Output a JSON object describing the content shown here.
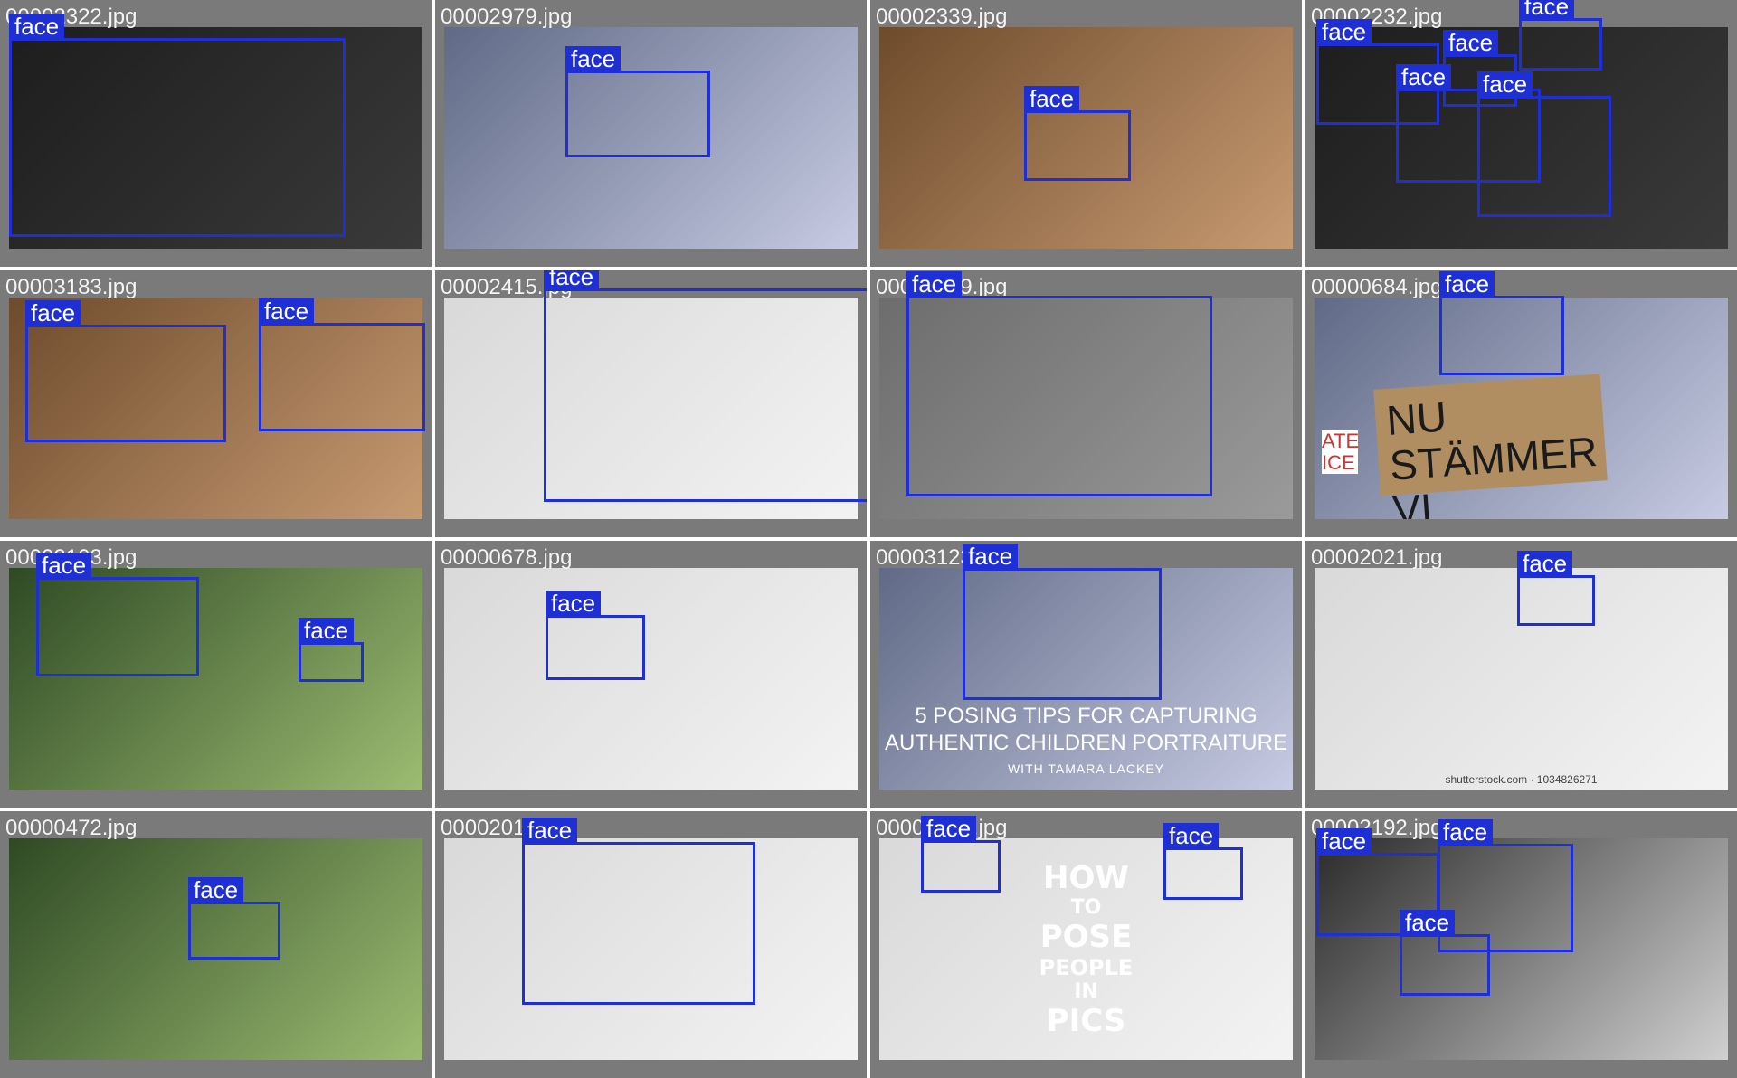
{
  "grid": {
    "tiles": [
      {
        "filename": "00002322.jpg",
        "boxes": [
          {
            "label": "face"
          }
        ]
      },
      {
        "filename": "00002979.jpg",
        "boxes": [
          {
            "label": "face"
          }
        ]
      },
      {
        "filename": "00002339.jpg",
        "boxes": [
          {
            "label": "face"
          }
        ]
      },
      {
        "filename": "00002232.jpg",
        "boxes": [
          {
            "label": "face"
          },
          {
            "label": "face"
          },
          {
            "label": "face"
          },
          {
            "label": "face"
          },
          {
            "label": "face"
          }
        ]
      },
      {
        "filename": "00003183.jpg",
        "boxes": [
          {
            "label": "face"
          },
          {
            "label": "face"
          }
        ]
      },
      {
        "filename": "00002415.jpg",
        "boxes": [
          {
            "label": "face"
          }
        ]
      },
      {
        "filename": "00001399.jpg",
        "boxes": [
          {
            "label": "face"
          }
        ]
      },
      {
        "filename": "00000684.jpg",
        "boxes": [
          {
            "label": "face"
          }
        ],
        "sign_lines": [
          "NU  STÄMMER",
          "VI  STATEN"
        ],
        "side_sign": "ATE ICE"
      },
      {
        "filename": "00002103.jpg",
        "boxes": [
          {
            "label": "face"
          },
          {
            "label": "face"
          }
        ]
      },
      {
        "filename": "00000678.jpg",
        "boxes": [
          {
            "label": "face"
          }
        ]
      },
      {
        "filename": "00003123.jpg",
        "boxes": [
          {
            "label": "face"
          }
        ],
        "headline_1": "5 POSING TIPS FOR CAPTURING",
        "headline_2": "AUTHENTIC  CHILDREN PORTRAITURE",
        "byline": "WITH TAMARA LACKEY"
      },
      {
        "filename": "00002021.jpg",
        "boxes": [
          {
            "label": "face"
          }
        ],
        "watermark": "shutterstock.com · 1034826271"
      },
      {
        "filename": "00000472.jpg",
        "boxes": [
          {
            "label": "face"
          }
        ]
      },
      {
        "filename": "00002012.jpg",
        "boxes": [
          {
            "label": "face"
          }
        ]
      },
      {
        "filename": "00001213.jpg",
        "boxes": [
          {
            "label": "face"
          },
          {
            "label": "face"
          }
        ],
        "poster_words": [
          "HOW",
          "TO",
          "POSE",
          "PEOPLE",
          "IN",
          "PICS"
        ]
      },
      {
        "filename": "00002192.jpg",
        "boxes": [
          {
            "label": "face"
          },
          {
            "label": "face"
          },
          {
            "label": "face"
          }
        ]
      }
    ]
  },
  "colors": {
    "box": "#1f2fd6",
    "tile_bg": "#7a7a7a",
    "label_text": "#ffffff"
  }
}
